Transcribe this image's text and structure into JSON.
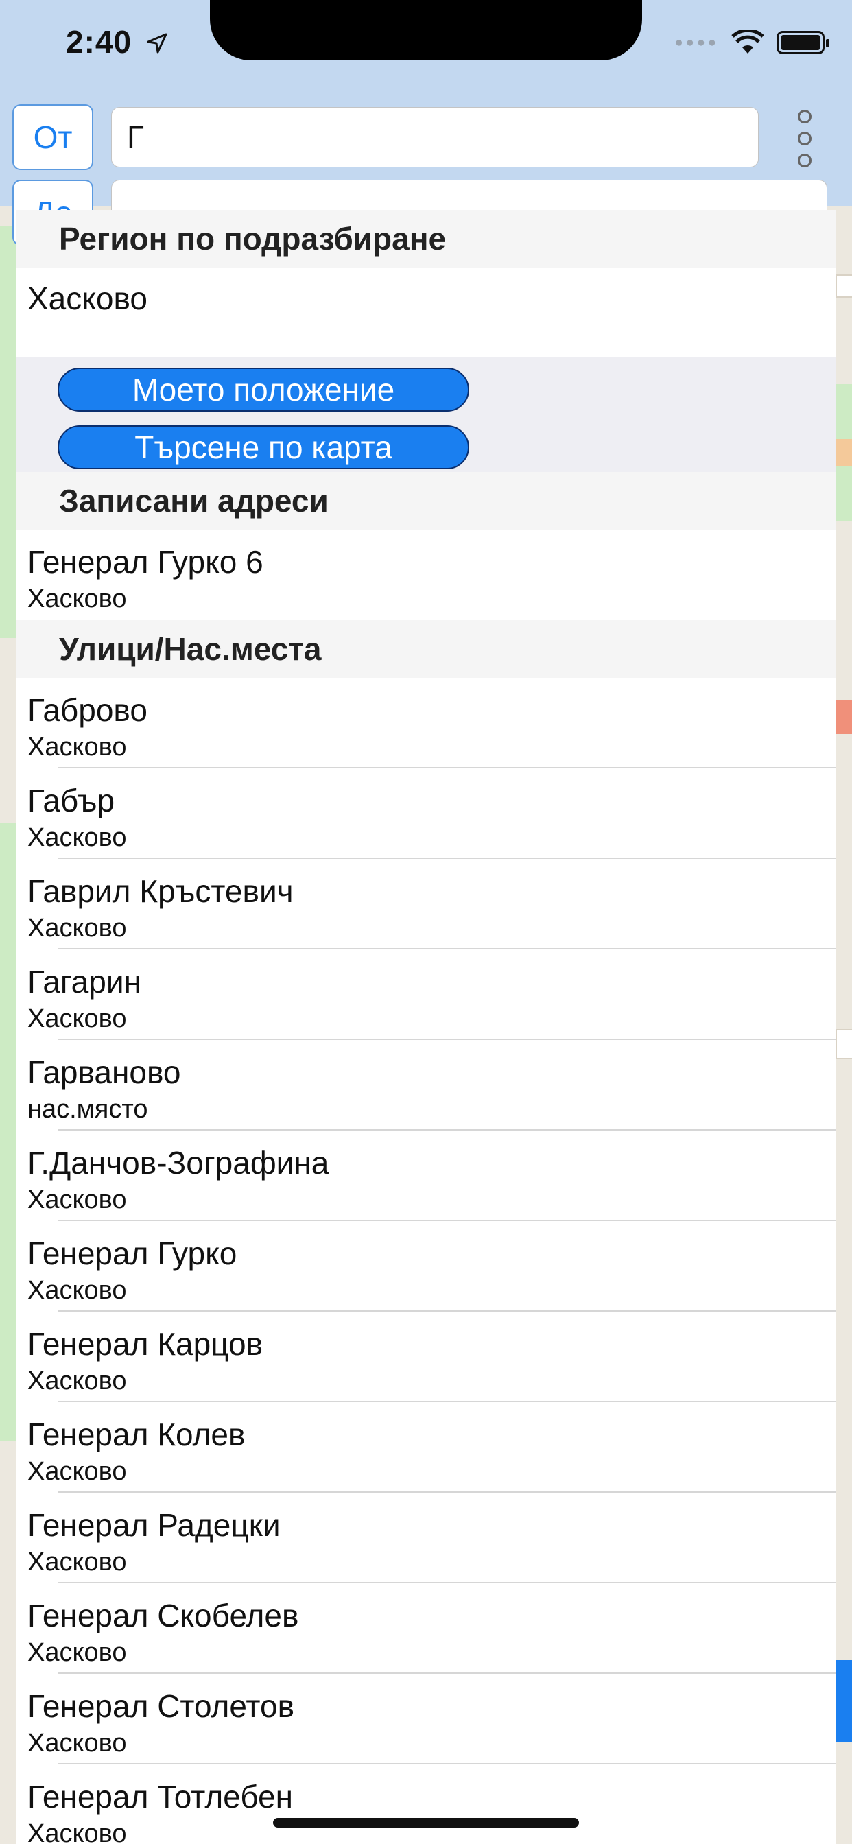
{
  "status_bar": {
    "time": "2:40"
  },
  "toolbar": {
    "from_label": "От",
    "to_label": "До",
    "from_value": "Г",
    "to_value": "",
    "more_icon": "more-vertical-icon"
  },
  "dropdown": {
    "default_region_header": "Регион по подразбиране",
    "default_region": "Хасково",
    "actions": [
      {
        "label": "Моето положение"
      },
      {
        "label": "Търсене по карта"
      }
    ],
    "saved_header": "Записани адреси",
    "saved": [
      {
        "title": "Генерал Гурко 6",
        "subtitle": "Хасково"
      }
    ],
    "streets_header": "Улици/Нас.места",
    "streets": [
      {
        "title": "Габрово",
        "subtitle": "Хасково"
      },
      {
        "title": "Габър",
        "subtitle": "Хасково"
      },
      {
        "title": "Гаврил Кръстевич",
        "subtitle": "Хасково"
      },
      {
        "title": "Гагарин",
        "subtitle": "Хасково"
      },
      {
        "title": "Гарваново",
        "subtitle": "нас.място"
      },
      {
        "title": "Г.Данчов-Зографина",
        "subtitle": "Хасково"
      },
      {
        "title": "Генерал Гурко",
        "subtitle": "Хасково"
      },
      {
        "title": "Генерал Карцов",
        "subtitle": "Хасково"
      },
      {
        "title": "Генерал Колев",
        "subtitle": "Хасково"
      },
      {
        "title": "Генерал Радецки",
        "subtitle": "Хасково"
      },
      {
        "title": "Генерал Скобелев",
        "subtitle": "Хасково"
      },
      {
        "title": "Генерал Столетов",
        "subtitle": "Хасково"
      },
      {
        "title": "Генерал Тотлебен",
        "subtitle": "Хасково"
      }
    ]
  }
}
